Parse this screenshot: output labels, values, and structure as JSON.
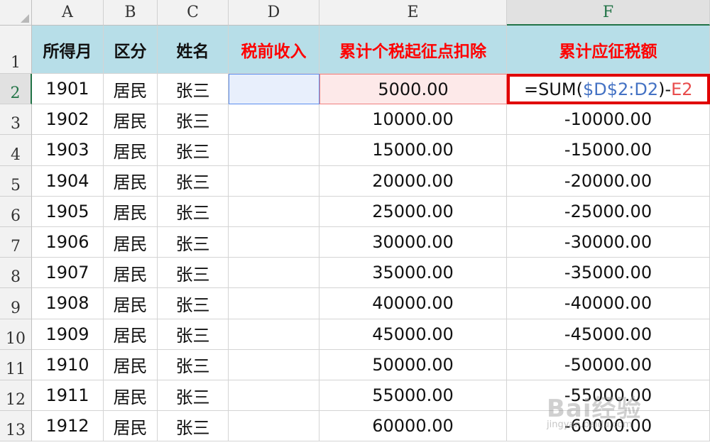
{
  "columns": [
    "A",
    "B",
    "C",
    "D",
    "E",
    "F"
  ],
  "active_column": "F",
  "headers": {
    "a": "所得月",
    "b": "区分",
    "c": "姓名",
    "d": "税前收入",
    "e": "累计个税起征点扣除",
    "f": "累计应征税额"
  },
  "rows": [
    {
      "num": "1"
    },
    {
      "num": "2",
      "a": "1901",
      "b": "居民",
      "c": "张三",
      "d": "",
      "e": "5000.00"
    },
    {
      "num": "3",
      "a": "1902",
      "b": "居民",
      "c": "张三",
      "d": "",
      "e": "10000.00",
      "f": "-10000.00"
    },
    {
      "num": "4",
      "a": "1903",
      "b": "居民",
      "c": "张三",
      "d": "",
      "e": "15000.00",
      "f": "-15000.00"
    },
    {
      "num": "5",
      "a": "1904",
      "b": "居民",
      "c": "张三",
      "d": "",
      "e": "20000.00",
      "f": "-20000.00"
    },
    {
      "num": "6",
      "a": "1905",
      "b": "居民",
      "c": "张三",
      "d": "",
      "e": "25000.00",
      "f": "-25000.00"
    },
    {
      "num": "7",
      "a": "1906",
      "b": "居民",
      "c": "张三",
      "d": "",
      "e": "30000.00",
      "f": "-30000.00"
    },
    {
      "num": "8",
      "a": "1907",
      "b": "居民",
      "c": "张三",
      "d": "",
      "e": "35000.00",
      "f": "-35000.00"
    },
    {
      "num": "9",
      "a": "1908",
      "b": "居民",
      "c": "张三",
      "d": "",
      "e": "40000.00",
      "f": "-40000.00"
    },
    {
      "num": "10",
      "a": "1909",
      "b": "居民",
      "c": "张三",
      "d": "",
      "e": "45000.00",
      "f": "-45000.00"
    },
    {
      "num": "11",
      "a": "1910",
      "b": "居民",
      "c": "张三",
      "d": "",
      "e": "50000.00",
      "f": "-50000.00"
    },
    {
      "num": "12",
      "a": "1911",
      "b": "居民",
      "c": "张三",
      "d": "",
      "e": "55000.00",
      "f": "-55000.00"
    },
    {
      "num": "13",
      "a": "1912",
      "b": "居民",
      "c": "张三",
      "d": "",
      "e": "60000.00",
      "f": "-60000.00"
    }
  ],
  "formula": {
    "prefix": "=SUM(",
    "range_ref": "$D$2:D2",
    "mid": ")-",
    "cell_ref": "E2"
  },
  "watermark": {
    "main": "Bai经验",
    "sub": "jingyan.baidu.com"
  },
  "colors": {
    "header_fill": "#b7dee8",
    "red_header": "#ff0000",
    "formula_box": "#e00000",
    "ref_blue": "#4472c4",
    "ref_red": "#e84c4c"
  }
}
